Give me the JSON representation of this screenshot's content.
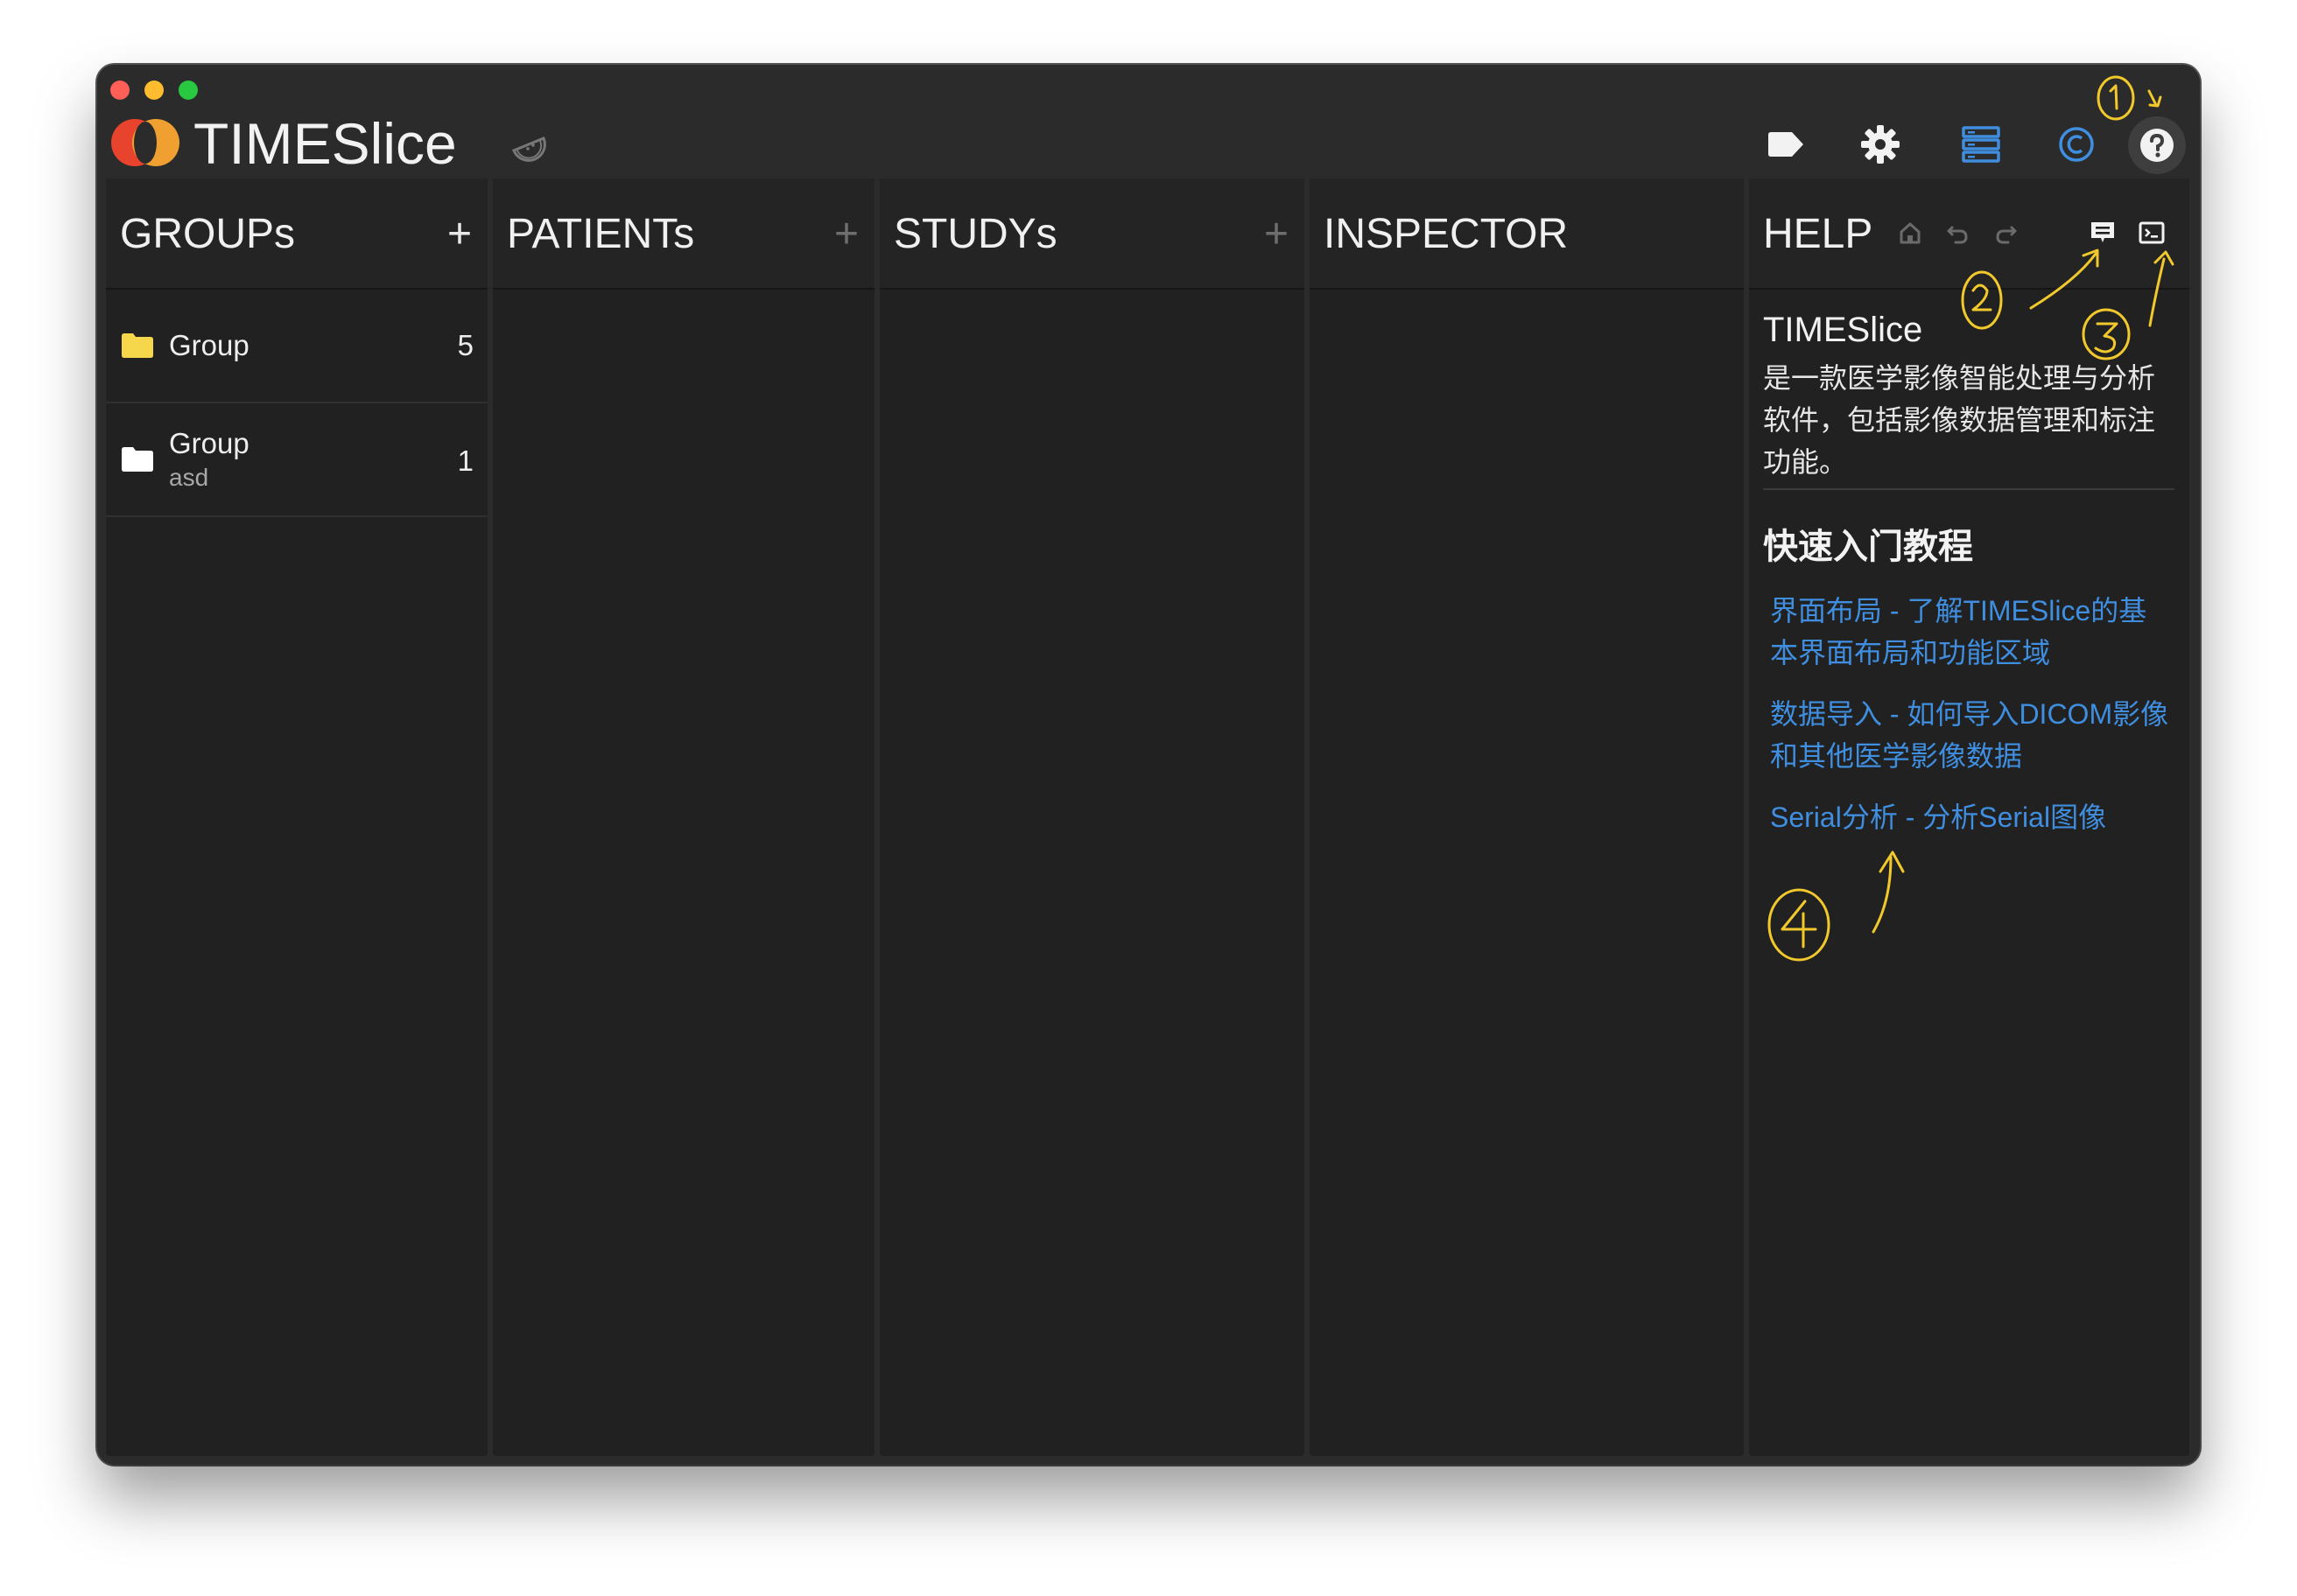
{
  "app": {
    "title": "TIMESlice"
  },
  "toolbar": {
    "icons": [
      "tag-icon",
      "gear-icon",
      "server-icon",
      "copyright-icon",
      "help-icon"
    ],
    "accent_color": "#3f8ee0"
  },
  "columns": {
    "groups": {
      "title": "GROUPs",
      "add_label": "+"
    },
    "patients": {
      "title": "PATIENTs",
      "add_label": "+"
    },
    "studies": {
      "title": "STUDYs",
      "add_label": "+"
    },
    "inspector": {
      "title": "INSPECTOR"
    },
    "help": {
      "title": "HELP"
    }
  },
  "groups": [
    {
      "name": "Group",
      "subtitle": "",
      "count": "5",
      "folder_color": "#f6d64a"
    },
    {
      "name": "Group",
      "subtitle": "asd",
      "count": "1",
      "folder_color": "#ffffff"
    }
  ],
  "help": {
    "heading": "TIMESlice",
    "description": "是一款医学影像智能处理与分析软件，包括影像数据管理和标注功能。",
    "section_title": "快速入门教程",
    "links": [
      "界面布局 - 了解TIMESlice的基本界面布局和功能区域",
      "数据导入 - 如何导入DICOM影像和其他医学影像数据",
      "Serial分析 - 分析Serial图像"
    ]
  }
}
